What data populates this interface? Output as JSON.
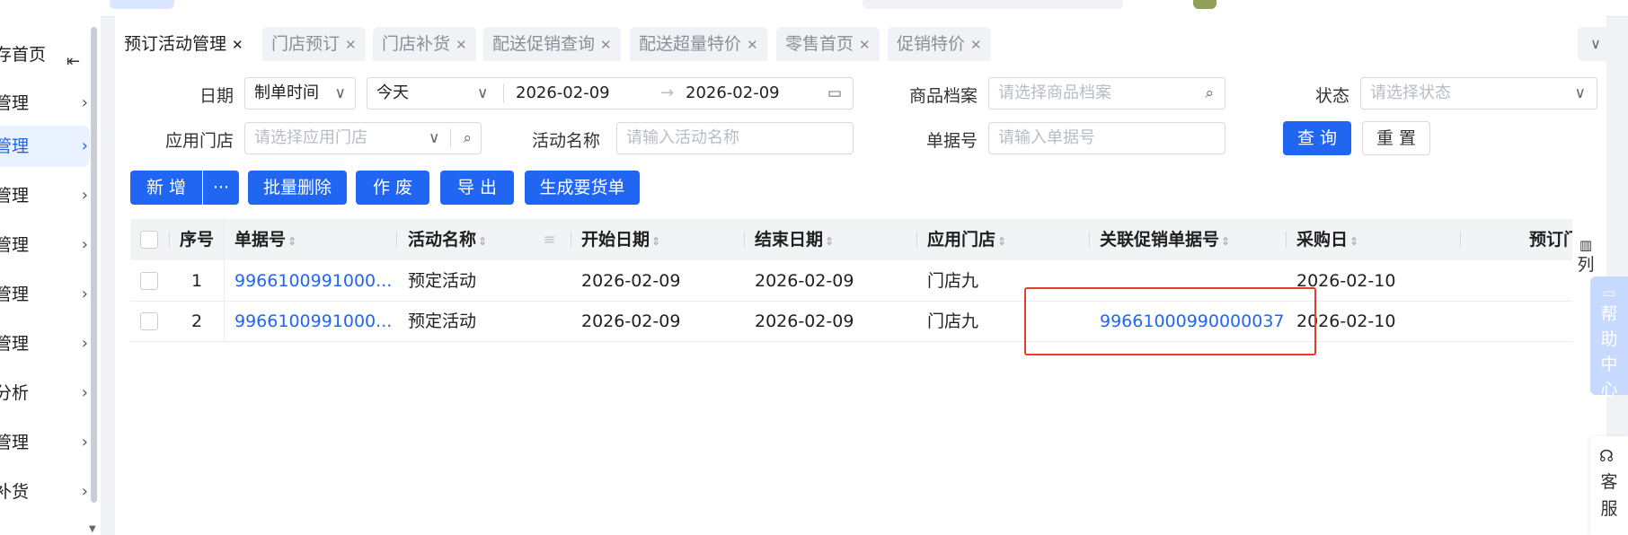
{
  "sidebar": {
    "items": [
      {
        "label": "存首页"
      },
      {
        "label": "管理"
      },
      {
        "label": "管理"
      },
      {
        "label": "管理"
      },
      {
        "label": "管理"
      },
      {
        "label": "管理"
      },
      {
        "label": "管理"
      },
      {
        "label": "分析"
      },
      {
        "label": "管理"
      },
      {
        "label": "补货"
      }
    ]
  },
  "tabs": [
    {
      "label": "预订活动管理"
    },
    {
      "label": "门店预订"
    },
    {
      "label": "门店补货"
    },
    {
      "label": "配送促销查询"
    },
    {
      "label": "配送超量特价"
    },
    {
      "label": "零售首页"
    },
    {
      "label": "促销特价"
    }
  ],
  "filters": {
    "date_label": "日期",
    "date_type": "制单时间",
    "date_range": "今天",
    "date_start": "2026-02-09",
    "date_end": "2026-02-09",
    "product_label": "商品档案",
    "product_placeholder": "请选择商品档案",
    "status_label": "状态",
    "status_placeholder": "请选择状态",
    "store_label": "应用门店",
    "store_placeholder": "请选择应用门店",
    "activity_label": "活动名称",
    "activity_placeholder": "请输入活动名称",
    "docno_label": "单据号",
    "docno_placeholder": "请输入单据号",
    "query_btn": "查 询",
    "reset_btn": "重 置"
  },
  "actions": {
    "add": "新 增",
    "more": "···",
    "batch_delete": "批量删除",
    "void": "作 废",
    "export": "导 出",
    "generate": "生成要货单"
  },
  "table": {
    "headers": [
      "序号",
      "单据号",
      "活动名称",
      "开始日期",
      "结束日期",
      "应用门店",
      "关联促销单据号",
      "采购日",
      "预订门"
    ],
    "rows": [
      {
        "seq": "1",
        "docno": "9966100991000...",
        "name": "预定活动",
        "start": "2026-02-09",
        "end": "2026-02-09",
        "store": "门店九",
        "promo": "",
        "purchase": "2026-02-10"
      },
      {
        "seq": "2",
        "docno": "9966100991000...",
        "name": "预定活动",
        "start": "2026-02-09",
        "end": "2026-02-09",
        "store": "门店九",
        "promo": "99661000990000037",
        "purchase": "2026-02-10"
      }
    ],
    "col_toggle": "列"
  },
  "float": {
    "help": "帮助中心",
    "service": "客服"
  },
  "colors": {
    "primary": "#2166f3",
    "highlight": "#e83b30"
  }
}
